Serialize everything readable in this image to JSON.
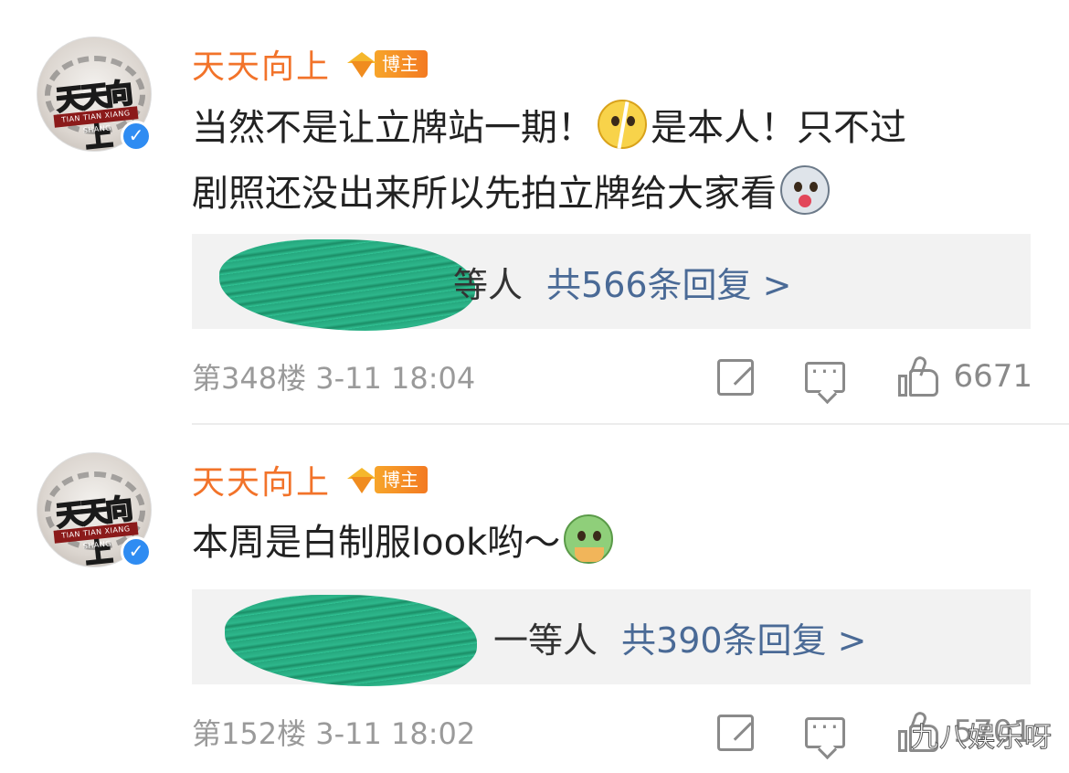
{
  "comments": [
    {
      "author": "天天向上",
      "badge": "博主",
      "avatar_text": "天天向上",
      "avatar_banner": "TIAN TIAN XIANG SHANG",
      "verified_symbol": "✓",
      "text_line1_a": "当然不是让立牌站一期！",
      "text_line1_b": "是本人！只不过",
      "text_line2": "剧照还没出来所以先拍立牌给大家看",
      "emoji1": "crack-face-emoji",
      "emoji2": "husky-emoji",
      "reply_users": "等人",
      "reply_count": "共566条回复 >",
      "floor_time": "第348楼  3-11 18:04",
      "likes": "6671"
    },
    {
      "author": "天天向上",
      "badge": "博主",
      "avatar_text": "天天向上",
      "avatar_banner": "TIAN TIAN XIANG SHANG",
      "verified_symbol": "✓",
      "text": "本周是白制服look哟～",
      "emoji1": "cactus-emoji",
      "reply_users": "一等人",
      "reply_count": "共390条回复 >",
      "floor_time": "第152楼  3-11 18:02",
      "likes": "5701"
    }
  ],
  "watermark": "九八娱乐呀",
  "colors": {
    "author": "#f2732a",
    "reply_link": "#4a6a96",
    "meta": "#9a9a9a",
    "verified": "#2f8cf2",
    "redaction": "#1fa57a"
  }
}
